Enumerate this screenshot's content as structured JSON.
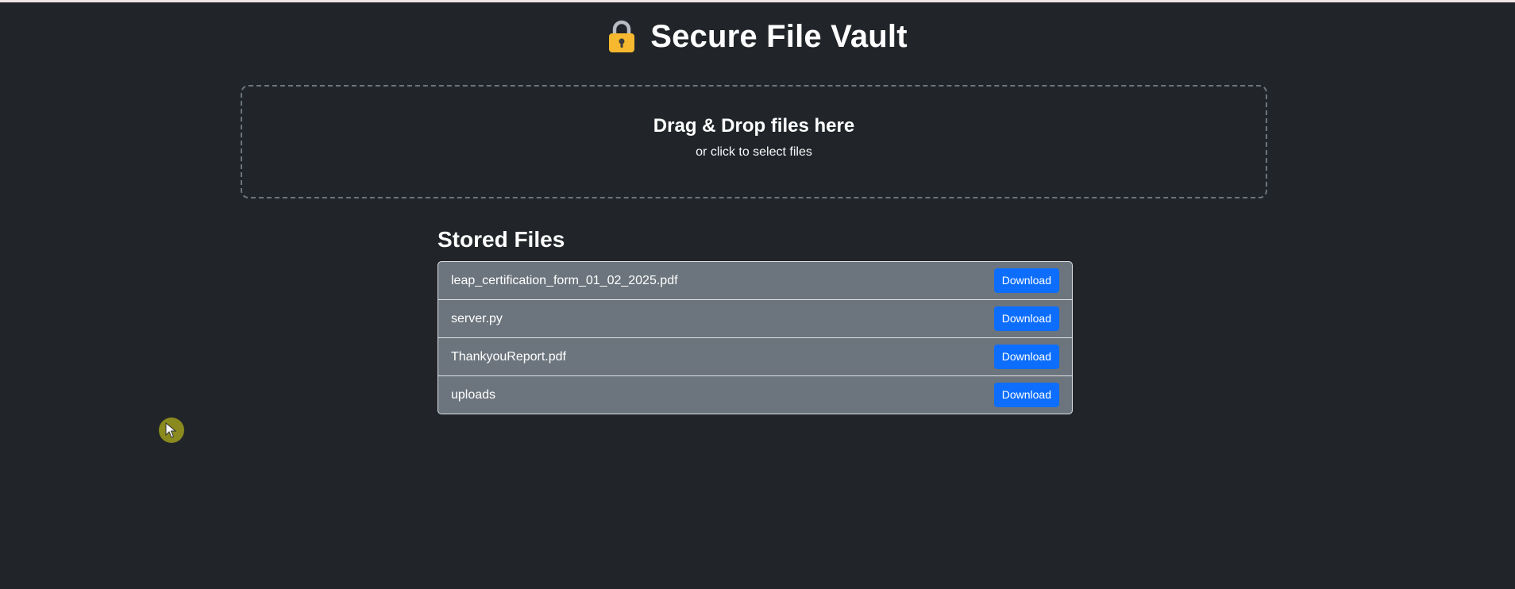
{
  "app": {
    "title": "Secure File Vault",
    "lock_icon": "lock-icon"
  },
  "colors": {
    "background": "#212529",
    "accent": "#0d6efd",
    "row_bg": "#6c757d",
    "lock": "#f5b82e"
  },
  "dropzone": {
    "title": "Drag & Drop files here",
    "subtitle": "or click to select files"
  },
  "files": {
    "heading": "Stored Files",
    "items": [
      {
        "name": "leap_certification_form_01_02_2025.pdf",
        "action": "Download"
      },
      {
        "name": "server.py",
        "action": "Download"
      },
      {
        "name": "ThankyouReport.pdf",
        "action": "Download"
      },
      {
        "name": "uploads",
        "action": "Download"
      }
    ]
  },
  "pointer": {
    "icon": "cursor-arrow-icon"
  }
}
